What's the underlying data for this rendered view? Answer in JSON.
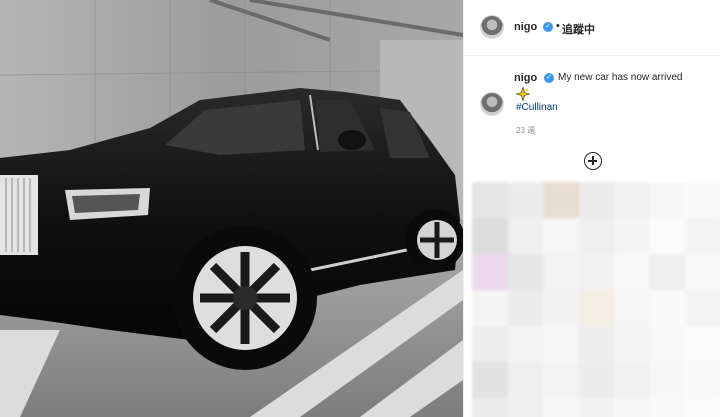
{
  "post": {
    "author": {
      "username": "nigo",
      "verified_icon": "verified-badge-icon",
      "follow_state": "追蹤中",
      "separator": "•"
    },
    "caption": {
      "username": "nigo",
      "text": "My new car has now arrived",
      "emoji": "sparkle-icon",
      "hashtag": "#Cullinan",
      "time_ago": "23 週"
    },
    "load_more_icon": "plus-circle-icon"
  },
  "colors": {
    "verified": "#3897f0",
    "hashtag": "#00376b",
    "text": "#262626",
    "muted": "#8e8e8e"
  },
  "blurred_comments_colors": [
    "#e5e5e5",
    "#ececec",
    "#e8ddd3",
    "#ebebeb",
    "#f2f2f2",
    "#f7f7f7",
    "#fafafa",
    "#dcdcdc",
    "#f0f0f0",
    "#f6f6f6",
    "#eeeeee",
    "#f5f5f5",
    "#fbfbfb",
    "#f4f4f4",
    "#ecd8ec",
    "#e6e6e6",
    "#f3f3f3",
    "#f1f1f1",
    "#f8f8f8",
    "#eeeeee",
    "#f9f9f9",
    "#f5f5f5",
    "#ebebeb",
    "#f2f2f2",
    "#f4efe5",
    "#f6f6f6",
    "#fafafa",
    "#f3f3f3",
    "#ededed",
    "#f4f4f4",
    "#f7f7f7",
    "#ededed",
    "#f5f5f5",
    "#f8f8f8",
    "#fbfbfb",
    "#e2e2e2",
    "#efefef",
    "#f3f3f3",
    "#ececec",
    "#f1f1f1",
    "#f7f7f7",
    "#fafafa",
    "#ebebeb",
    "#f0f0f0",
    "#f6f6f6",
    "#f2f2f2",
    "#f7f7f7",
    "#f9f9f9",
    "#fcfcfc"
  ]
}
